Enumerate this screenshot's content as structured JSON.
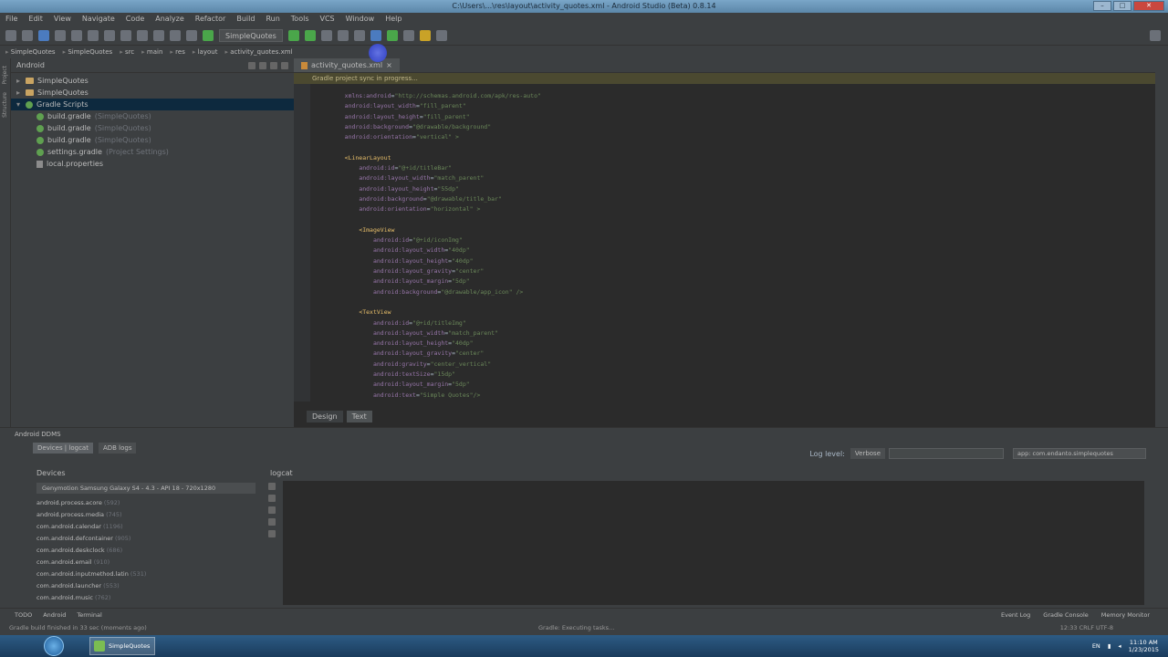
{
  "window": {
    "title": "C:\\Users\\...\\res\\layout\\activity_quotes.xml - Android Studio (Beta) 0.8.14"
  },
  "menu": [
    "File",
    "Edit",
    "View",
    "Navigate",
    "Code",
    "Analyze",
    "Refactor",
    "Build",
    "Run",
    "Tools",
    "VCS",
    "Window",
    "Help"
  ],
  "toolbar": {
    "run_config": "SimpleQuotes"
  },
  "navbar": {
    "crumbs": [
      "SimpleQuotes",
      "SimpleQuotes",
      "src",
      "main",
      "res",
      "layout",
      "activity_quotes.xml"
    ]
  },
  "project": {
    "header": "Android",
    "items": [
      {
        "name": "SimpleQuotes",
        "note": ""
      },
      {
        "name": "SimpleQuotes",
        "note": ""
      },
      {
        "name": "Gradle Scripts",
        "note": ""
      },
      {
        "name": "build.gradle",
        "note": "(SimpleQuotes)"
      },
      {
        "name": "build.gradle",
        "note": "(SimpleQuotes)"
      },
      {
        "name": "build.gradle",
        "note": "(SimpleQuotes)"
      },
      {
        "name": "settings.gradle",
        "note": "(Project Settings)"
      },
      {
        "name": "local.properties",
        "note": ""
      }
    ]
  },
  "editor": {
    "tab": "activity_quotes.xml",
    "notice": "Gradle project sync in progress...",
    "bottom_tabs": [
      "Design",
      "Text"
    ],
    "lines": [
      {
        "i": 1,
        "attr": "xmlns:android",
        "val": "\"http://schemas.android.com/apk/res-auto\""
      },
      {
        "i": 1,
        "attr": "android:layout_width",
        "val": "\"fill_parent\""
      },
      {
        "i": 1,
        "attr": "android:layout_height",
        "val": "\"fill_parent\""
      },
      {
        "i": 1,
        "attr": "android:background",
        "val": "\"@drawable/background\""
      },
      {
        "i": 1,
        "attr": "android:orientation",
        "val": "\"vertical\" >"
      },
      {
        "i": 0,
        "tag": "",
        "attr": "",
        "val": ""
      },
      {
        "i": 1,
        "tag": "<LinearLayout"
      },
      {
        "i": 2,
        "attr": "android:id",
        "val": "\"@+id/titleBar\""
      },
      {
        "i": 2,
        "attr": "android:layout_width",
        "val": "\"match_parent\""
      },
      {
        "i": 2,
        "attr": "android:layout_height",
        "val": "\"55dp\""
      },
      {
        "i": 2,
        "attr": "android:background",
        "val": "\"@drawable/title_bar\""
      },
      {
        "i": 2,
        "attr": "android:orientation",
        "val": "\"horizontal\" >"
      },
      {
        "i": 0,
        "tag": "",
        "attr": "",
        "val": ""
      },
      {
        "i": 2,
        "tag": "<ImageView"
      },
      {
        "i": 3,
        "attr": "android:id",
        "val": "\"@+id/iconImg\""
      },
      {
        "i": 3,
        "attr": "android:layout_width",
        "val": "\"40dp\""
      },
      {
        "i": 3,
        "attr": "android:layout_height",
        "val": "\"40dp\""
      },
      {
        "i": 3,
        "attr": "android:layout_gravity",
        "val": "\"center\""
      },
      {
        "i": 3,
        "attr": "android:layout_margin",
        "val": "\"5dp\""
      },
      {
        "i": 3,
        "attr": "android:background",
        "val": "\"@drawable/app_icon\" />"
      },
      {
        "i": 0,
        "tag": "",
        "attr": "",
        "val": ""
      },
      {
        "i": 2,
        "tag": "<TextView"
      },
      {
        "i": 3,
        "attr": "android:id",
        "val": "\"@+id/titleImg\""
      },
      {
        "i": 3,
        "attr": "android:layout_width",
        "val": "\"match_parent\""
      },
      {
        "i": 3,
        "attr": "android:layout_height",
        "val": "\"40dp\""
      },
      {
        "i": 3,
        "attr": "android:layout_gravity",
        "val": "\"center\""
      },
      {
        "i": 3,
        "attr": "android:gravity",
        "val": "\"center_vertical\""
      },
      {
        "i": 3,
        "attr": "android:textSize",
        "val": "\"15dp\""
      },
      {
        "i": 3,
        "attr": "android:layout_margin",
        "val": "\"5dp\""
      },
      {
        "i": 3,
        "attr": "android:text",
        "val": "\"Simple Quotes\"/>"
      }
    ]
  },
  "android_panel": {
    "title": "Android DDMS",
    "tabs": [
      "Devices | logcat",
      "ADB logs"
    ],
    "devices_header": "Devices",
    "device": "Genymotion Samsung Galaxy S4 - 4.3 - API 18 - 720x1280",
    "processes": [
      {
        "name": "android.process.acore",
        "pid": "(592)"
      },
      {
        "name": "android.process.media",
        "pid": "(745)"
      },
      {
        "name": "com.android.calendar",
        "pid": "(1196)"
      },
      {
        "name": "com.android.defcontainer",
        "pid": "(905)"
      },
      {
        "name": "com.android.deskclock",
        "pid": "(686)"
      },
      {
        "name": "com.android.email",
        "pid": "(910)"
      },
      {
        "name": "com.android.inputmethod.latin",
        "pid": "(531)"
      },
      {
        "name": "com.android.launcher",
        "pid": "(553)"
      },
      {
        "name": "com.android.music",
        "pid": "(762)"
      }
    ],
    "logcat_header": "logcat",
    "log_level_label": "Log level:",
    "log_level": "Verbose",
    "app_filter": "app: com.endanto.simplequotes"
  },
  "statusbar": {
    "toolwins_left": [
      "TODO",
      "Android",
      "Terminal"
    ],
    "toolwins_right": [
      "Event Log",
      "Gradle Console",
      "Memory Monitor"
    ],
    "message": "Gradle build finished in 33 sec (moments ago)",
    "center": "Gradle: Executing tasks...",
    "position": "12:33  CRLF  UTF-8"
  },
  "taskbar": {
    "app": "SimpleQuotes",
    "lang": "EN",
    "time": "11:10 AM",
    "date": "1/23/2015"
  }
}
